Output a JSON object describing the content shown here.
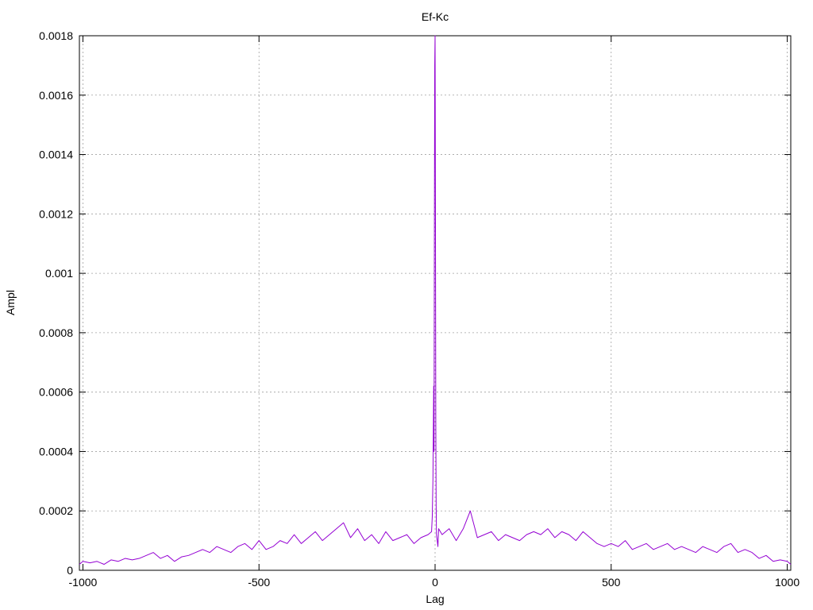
{
  "chart_data": {
    "type": "line",
    "title": "Ef-Kc",
    "xlabel": "Lag",
    "ylabel": "Ampl",
    "xlim": [
      -1010,
      1010
    ],
    "ylim": [
      0,
      0.0018
    ],
    "xticks": [
      -1000,
      -500,
      0,
      500,
      1000
    ],
    "xtick_labels": [
      "-1000",
      "-500",
      "0",
      "500",
      "1000"
    ],
    "yticks": [
      0,
      0.0002,
      0.0004,
      0.0006,
      0.0008,
      0.001,
      0.0012,
      0.0014,
      0.0016,
      0.0018
    ],
    "ytick_labels": [
      "0",
      "0.0002",
      "0.0004",
      "0.0006",
      "0.0008",
      "0.001",
      "0.0012",
      "0.0014",
      "0.0016",
      "0.0018"
    ],
    "grid": true,
    "legend": "none",
    "series": [
      {
        "color": "#9400D3",
        "x": [
          -1010,
          -1000,
          -980,
          -960,
          -940,
          -920,
          -900,
          -880,
          -860,
          -840,
          -820,
          -800,
          -780,
          -760,
          -740,
          -720,
          -700,
          -680,
          -660,
          -640,
          -620,
          -600,
          -580,
          -560,
          -540,
          -520,
          -500,
          -480,
          -460,
          -440,
          -420,
          -400,
          -380,
          -360,
          -340,
          -320,
          -300,
          -280,
          -260,
          -240,
          -220,
          -200,
          -180,
          -160,
          -140,
          -120,
          -100,
          -80,
          -60,
          -40,
          -20,
          -10,
          -8,
          -6,
          -4,
          -3,
          -2,
          -1,
          0,
          1,
          2,
          3,
          4,
          6,
          8,
          10,
          20,
          40,
          60,
          80,
          100,
          120,
          140,
          160,
          180,
          200,
          220,
          240,
          260,
          280,
          300,
          320,
          340,
          360,
          380,
          400,
          420,
          440,
          460,
          480,
          500,
          520,
          540,
          560,
          580,
          600,
          620,
          640,
          660,
          680,
          700,
          720,
          740,
          760,
          780,
          800,
          820,
          840,
          860,
          880,
          900,
          920,
          940,
          960,
          980,
          1000,
          1010
        ],
        "y": [
          2e-05,
          3e-05,
          2.5e-05,
          3e-05,
          2e-05,
          3.5e-05,
          3e-05,
          4e-05,
          3.5e-05,
          4e-05,
          5e-05,
          6e-05,
          4e-05,
          5e-05,
          3e-05,
          4.5e-05,
          5e-05,
          6e-05,
          7e-05,
          6e-05,
          8e-05,
          7e-05,
          6e-05,
          8e-05,
          9e-05,
          7e-05,
          0.0001,
          7e-05,
          8e-05,
          0.0001,
          9e-05,
          0.00012,
          9e-05,
          0.00011,
          0.00013,
          0.0001,
          0.00012,
          0.00014,
          0.00016,
          0.00011,
          0.00014,
          0.0001,
          0.00012,
          9e-05,
          0.00013,
          0.0001,
          0.00011,
          0.00012,
          9e-05,
          0.00011,
          0.00012,
          0.00013,
          0.00018,
          0.00031,
          0.00062,
          0.0004,
          0.00112,
          0.0017,
          0.0018,
          0.00125,
          0.0005,
          0.00022,
          0.00012,
          0.0001,
          8e-05,
          0.00014,
          0.00012,
          0.00014,
          0.0001,
          0.00014,
          0.0002,
          0.00011,
          0.00012,
          0.00013,
          0.0001,
          0.00012,
          0.00011,
          0.0001,
          0.00012,
          0.00013,
          0.00012,
          0.00014,
          0.00011,
          0.00013,
          0.00012,
          0.0001,
          0.00013,
          0.00011,
          9e-05,
          8e-05,
          9e-05,
          8e-05,
          0.0001,
          7e-05,
          8e-05,
          9e-05,
          7e-05,
          8e-05,
          9e-05,
          7e-05,
          8e-05,
          7e-05,
          6e-05,
          8e-05,
          7e-05,
          6e-05,
          8e-05,
          9e-05,
          6e-05,
          7e-05,
          6e-05,
          4e-05,
          5e-05,
          3e-05,
          3.5e-05,
          3e-05,
          2e-05
        ]
      }
    ]
  }
}
